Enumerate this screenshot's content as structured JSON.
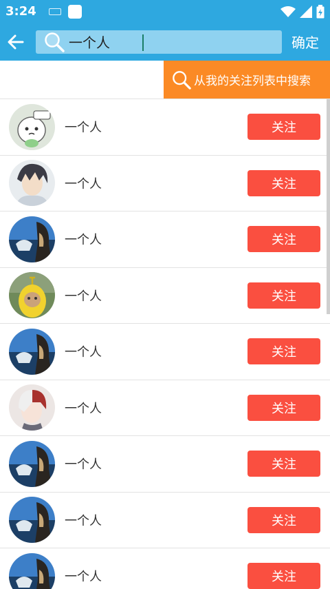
{
  "status_bar": {
    "time": "3:24"
  },
  "toolbar": {
    "search_value": "一个人",
    "confirm_label": "确定"
  },
  "follow_search": {
    "label": "从我的关注列表中搜索"
  },
  "users": [
    {
      "name": "一个人",
      "button": "关注",
      "avatar_icon": "cartoon-egg-avatar-icon"
    },
    {
      "name": "一个人",
      "button": "关注",
      "avatar_icon": "anime-boy-avatar-icon"
    },
    {
      "name": "一个人",
      "button": "关注",
      "avatar_icon": "sea-scene-avatar-icon"
    },
    {
      "name": "一个人",
      "button": "关注",
      "avatar_icon": "teletubby-avatar-icon"
    },
    {
      "name": "一个人",
      "button": "关注",
      "avatar_icon": "sea-scene-avatar-icon"
    },
    {
      "name": "一个人",
      "button": "关注",
      "avatar_icon": "anime-girl-avatar-icon"
    },
    {
      "name": "一个人",
      "button": "关注",
      "avatar_icon": "sea-scene-avatar-icon"
    },
    {
      "name": "一个人",
      "button": "关注",
      "avatar_icon": "sea-scene-avatar-icon"
    },
    {
      "name": "一个人",
      "button": "关注",
      "avatar_icon": "sea-scene-avatar-icon"
    }
  ],
  "colors": {
    "header": "#2ea8e0",
    "search_field": "#8fd2f0",
    "follow_search_button": "#fb8a25",
    "follow_button": "#fa4f40"
  }
}
